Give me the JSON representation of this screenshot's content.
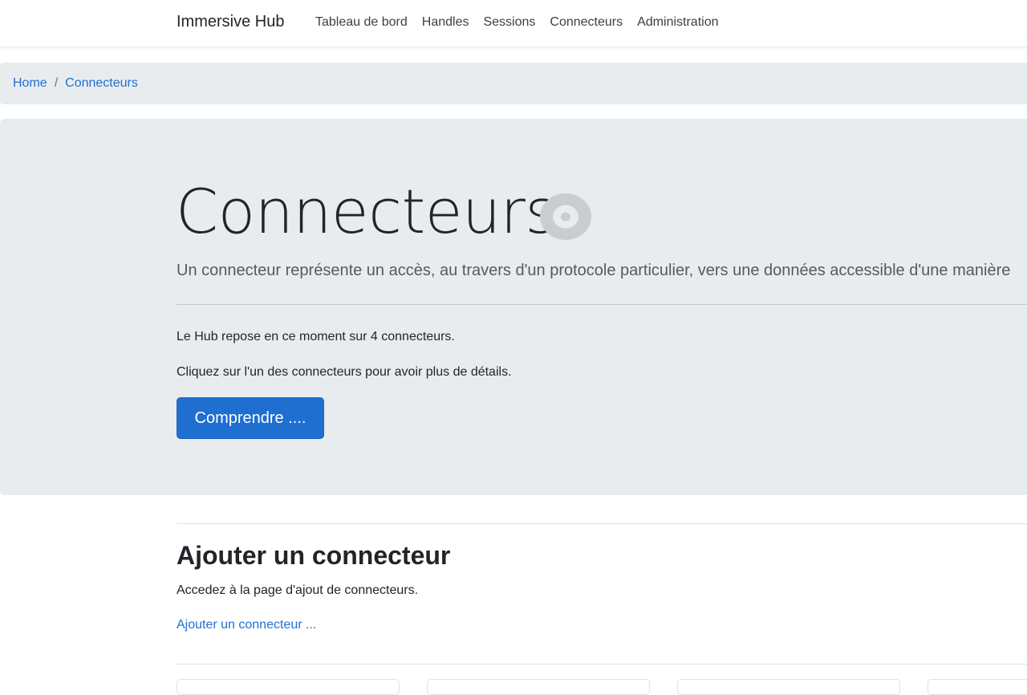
{
  "navbar": {
    "brand": "Immersive Hub",
    "links": [
      "Tableau de bord",
      "Handles",
      "Sessions",
      "Connecteurs",
      "Administration"
    ]
  },
  "breadcrumb": {
    "items": [
      "Home",
      "Connecteurs"
    ],
    "separator": "/"
  },
  "jumbotron": {
    "title": "Connecteurs",
    "icon": "target-icon",
    "lead": "Un connecteur représente un accès, au travers d'un protocole particulier, vers une données accessible d'une manière",
    "text1": "Le Hub repose en ce moment sur 4 connecteurs.",
    "text2": "Cliquez sur l'un des connecteurs pour avoir plus de détails.",
    "button": "Comprendre ...."
  },
  "add_section": {
    "title": "Ajouter un connecteur",
    "text": "Accedez à la page d'ajout de connecteurs.",
    "link": "Ajouter un connecteur ..."
  },
  "colors": {
    "primary": "#1f6fd1",
    "jumbotron_bg": "#e9ecef",
    "text": "#212529"
  }
}
